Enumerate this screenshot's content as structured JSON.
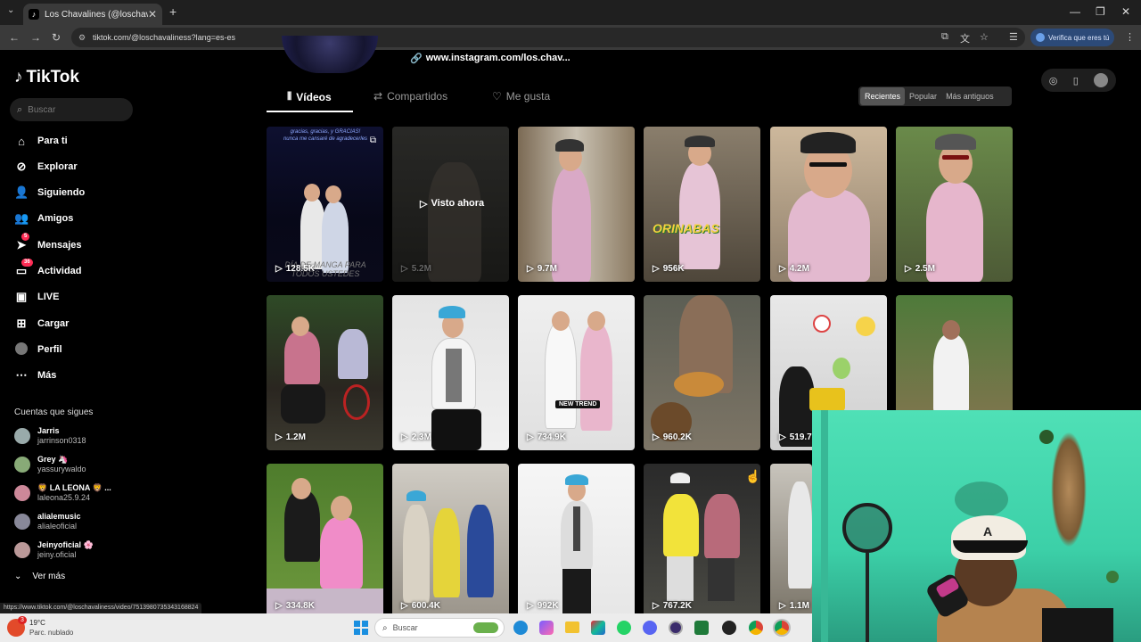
{
  "browser": {
    "tab_title": "Los Chavalines (@loschavaline...",
    "url": "tiktok.com/@loschavaliness?lang=es-es",
    "verify_label": "Verifica que eres tú",
    "status_url": "https://www.tiktok.com/@loschavaliness/video/7513980735343168824"
  },
  "sidebar": {
    "logo": "TikTok",
    "search_placeholder": "Buscar",
    "nav": [
      {
        "label": "Para ti",
        "icon": "home-icon"
      },
      {
        "label": "Explorar",
        "icon": "compass-icon"
      },
      {
        "label": "Siguiendo",
        "icon": "following-icon"
      },
      {
        "label": "Amigos",
        "icon": "friends-icon"
      },
      {
        "label": "Mensajes",
        "icon": "messages-icon",
        "badge": "5"
      },
      {
        "label": "Actividad",
        "icon": "activity-icon",
        "badge": "36"
      },
      {
        "label": "LIVE",
        "icon": "live-icon"
      },
      {
        "label": "Cargar",
        "icon": "upload-icon"
      },
      {
        "label": "Perfil",
        "icon": "profile-icon"
      },
      {
        "label": "Más",
        "icon": "more-icon"
      }
    ],
    "following_header": "Cuentas que sigues",
    "following": [
      {
        "name": "Jarris",
        "handle": "jarrinson0318"
      },
      {
        "name": "Grey 🦄",
        "handle": "yassurywaldo"
      },
      {
        "name": "🦁 LA LEONA 🦁 ...",
        "handle": "laleona25.9.24"
      },
      {
        "name": "alialemusic",
        "handle": "alialeoficial"
      },
      {
        "name": "Jeinyoficial 🌸",
        "handle": "jeiny.oficial"
      }
    ],
    "see_more": "Ver más"
  },
  "profile": {
    "link": "www.instagram.com/los.chav...",
    "tabs": [
      "Vídeos",
      "Compartidos",
      "Me gusta"
    ],
    "sort": [
      "Recientes",
      "Popular",
      "Más antiguos"
    ],
    "watched_label": "Visto ahora"
  },
  "videos": [
    {
      "views": "128.5K",
      "overlay": "DÍA DE MANGA PARA TODOS USTEDES",
      "top_text": "gracias, gracias, y GRACIAS! nunca me cansaré de agradecerles"
    },
    {
      "views": "5.2M"
    },
    {
      "views": "9.7M"
    },
    {
      "views": "956K",
      "overlay": "ORINABAS"
    },
    {
      "views": "4.2M"
    },
    {
      "views": "2.5M"
    },
    {
      "views": "1.2M"
    },
    {
      "views": "2.3M"
    },
    {
      "views": "734.9K",
      "overlay": "NEW TREND"
    },
    {
      "views": "960.2K"
    },
    {
      "views": "519.7K"
    },
    {
      "views": ""
    },
    {
      "views": "334.8K"
    },
    {
      "views": "600.4K"
    },
    {
      "views": "992K"
    },
    {
      "views": "767.2K"
    },
    {
      "views": "1.1M"
    }
  ],
  "taskbar": {
    "weather_temp": "19°C",
    "weather_desc": "Parc. nublado",
    "search_placeholder": "Buscar",
    "weather_badge": "3"
  },
  "colors": {
    "accent": "#fe2c55",
    "background": "#000000",
    "webcam_wall": "#3cd0a8"
  }
}
